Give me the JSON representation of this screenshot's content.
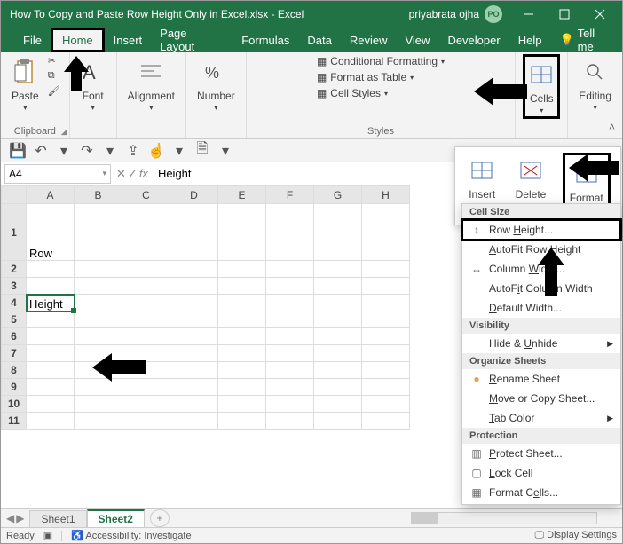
{
  "titlebar": {
    "filename": "How To Copy and Paste Row Height Only in Excel.xlsx",
    "app": "Excel",
    "separator": "  -  ",
    "user_name": "priyabrata ojha",
    "user_initials": "PO"
  },
  "menu": {
    "tabs": [
      "File",
      "Home",
      "Insert",
      "Page Layout",
      "Formulas",
      "Data",
      "Review",
      "View",
      "Developer",
      "Help"
    ],
    "active": "Home",
    "tell_me": "Tell me"
  },
  "ribbon": {
    "clipboard": {
      "label": "Clipboard",
      "paste": "Paste"
    },
    "font": {
      "label": "Font",
      "btn": "Font"
    },
    "alignment": {
      "label": "Alignment",
      "btn": "Alignment"
    },
    "number": {
      "label": "Number",
      "btn": "Number"
    },
    "styles": {
      "label": "Styles",
      "cond": "Conditional Formatting",
      "table": "Format as Table",
      "cellstyles": "Cell Styles"
    },
    "cells": {
      "btn": "Cells"
    },
    "editing": {
      "btn": "Editing"
    }
  },
  "popup_idf": {
    "insert": "Insert",
    "delete": "Delete",
    "format": "Format"
  },
  "format_menu": {
    "cell_size": "Cell Size",
    "row_height": "Row Height...",
    "autofit_row": "AutoFit Row Height",
    "col_width": "Column Width...",
    "autofit_col": "AutoFit Column Width",
    "default_width": "Default Width...",
    "visibility": "Visibility",
    "hide_unhide": "Hide & Unhide",
    "organize": "Organize Sheets",
    "rename": "Rename Sheet",
    "move_copy": "Move or Copy Sheet...",
    "tab_color": "Tab Color",
    "protection": "Protection",
    "protect": "Protect Sheet...",
    "lock": "Lock Cell",
    "format_cells": "Format Cells..."
  },
  "formula_bar": {
    "namebox": "A4",
    "formula_value": "Height"
  },
  "grid": {
    "columns": [
      "A",
      "B",
      "C",
      "D",
      "E",
      "F",
      "G",
      "H"
    ],
    "rows": [
      "1",
      "2",
      "3",
      "4",
      "5",
      "6",
      "7",
      "8",
      "9",
      "10",
      "11"
    ],
    "selected": "A4",
    "data": {
      "A1": "Row",
      "A4": "Height"
    }
  },
  "sheets": {
    "tabs": [
      "Sheet1",
      "Sheet2"
    ],
    "active": "Sheet2"
  },
  "statusbar": {
    "mode": "Ready",
    "accessibility": "Accessibility: Investigate",
    "display": "Display Settings"
  }
}
